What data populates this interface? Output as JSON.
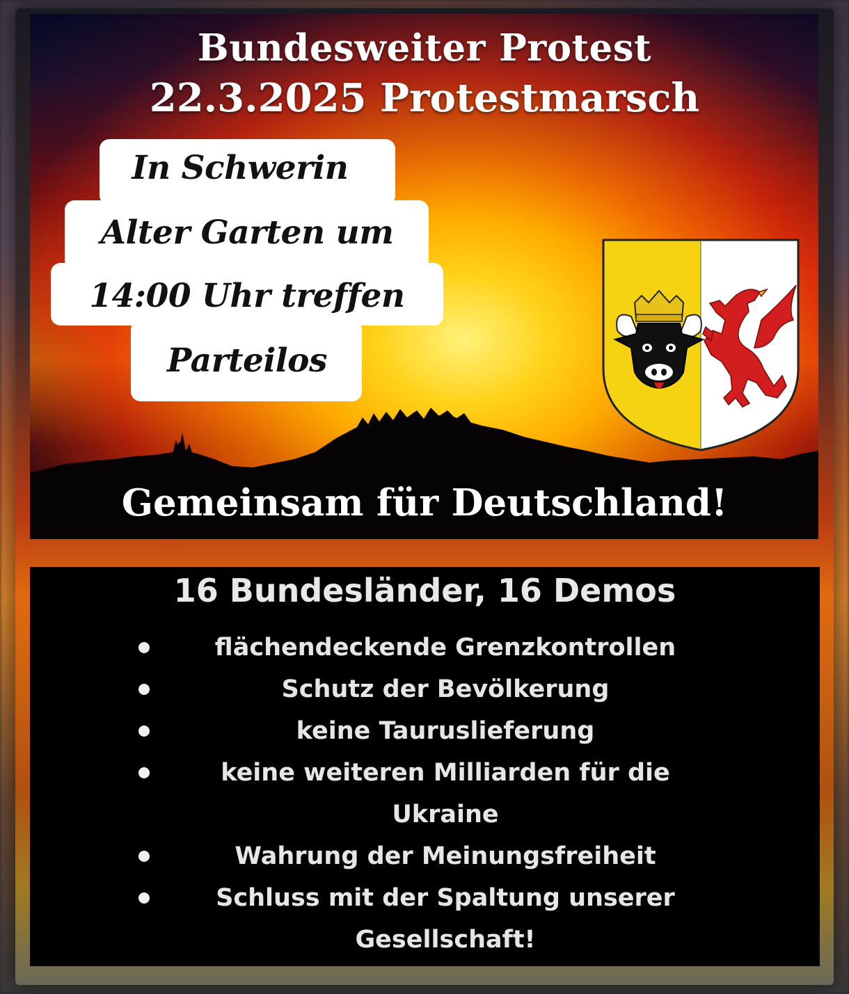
{
  "header": {
    "title_line1": "Bundesweiter Protest",
    "title_line2": "22.3.2025 Protestmarsch"
  },
  "location_box": {
    "line1": "In Schwerin",
    "line2": "Alter Garten um",
    "line3": "14:00 Uhr treffen",
    "line4": "Parteilos"
  },
  "crest": {
    "left_field_color": "#f5d312",
    "right_field_color": "#ffffff",
    "left_charge": "bull-head-icon",
    "right_charge": "griffin-icon",
    "griffin_color": "#d21e1e"
  },
  "slogan": "Gemeinsam für Deutschland!",
  "demands": {
    "heading": "16 Bundesländer, 16 Demos",
    "items": [
      {
        "text": "flächendeckende Grenzkontrollen"
      },
      {
        "text": "Schutz der Bevölkerung"
      },
      {
        "text": "keine Tauruslieferung"
      },
      {
        "line1": "keine weiteren Milliarden für die",
        "line2": "Ukraine"
      },
      {
        "text": "Wahrung der Meinungsfreiheit"
      },
      {
        "line1": "Schluss mit der Spaltung unserer",
        "line2": "Gesellschaft!"
      }
    ]
  }
}
